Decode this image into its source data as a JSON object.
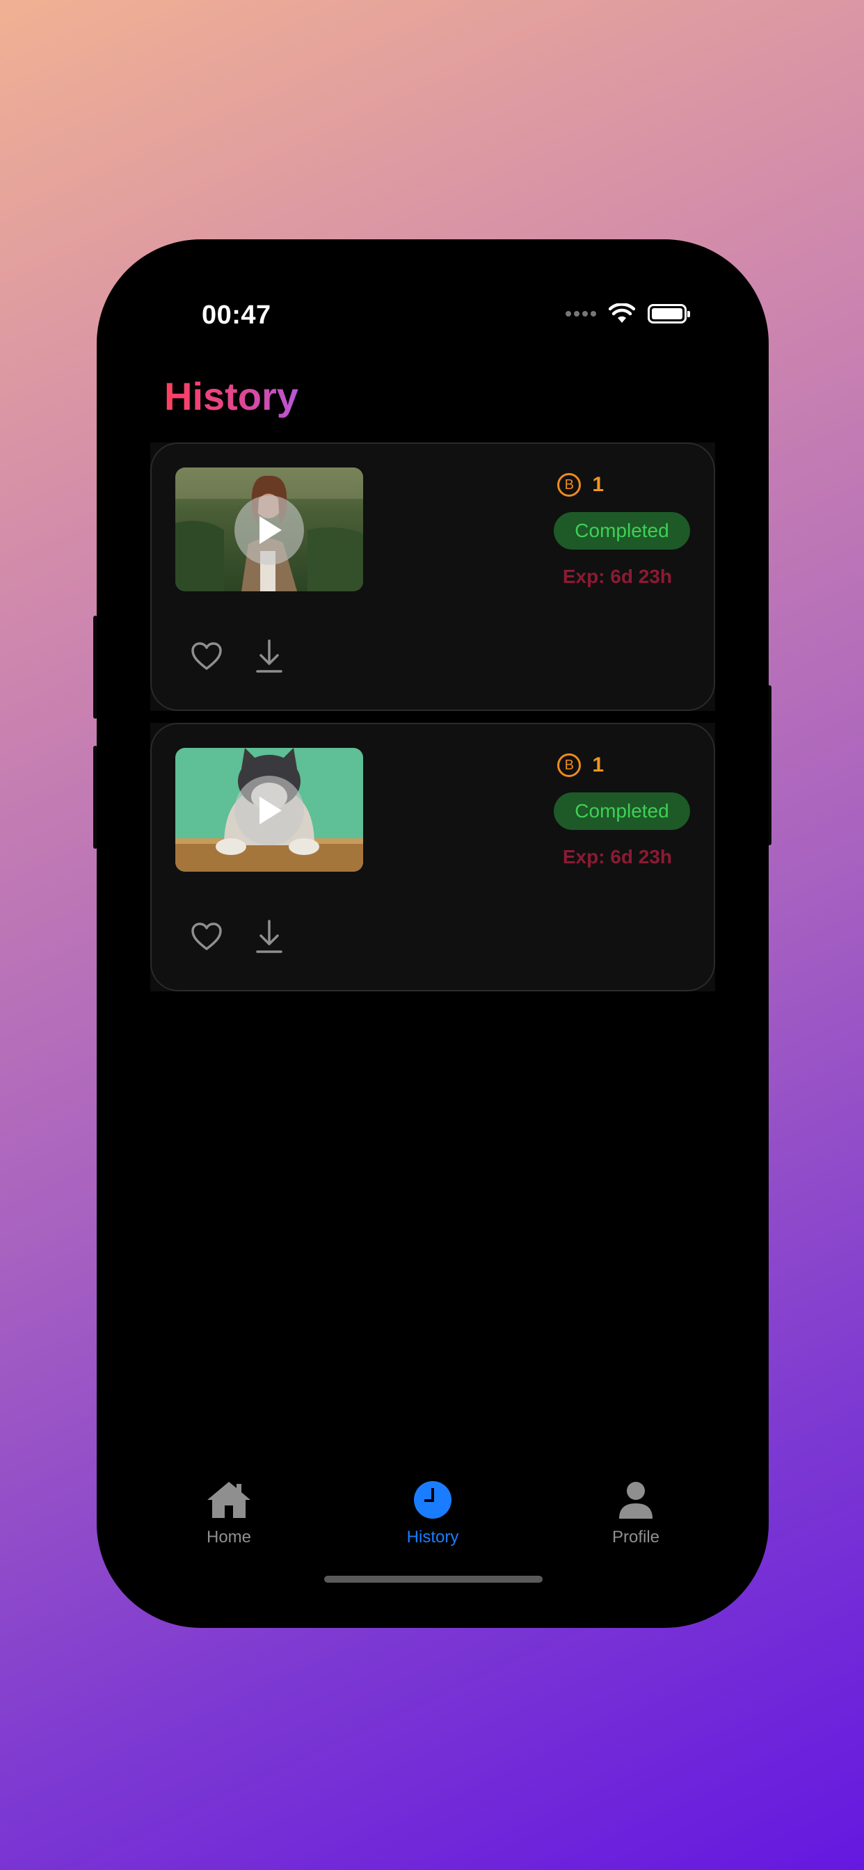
{
  "status_bar": {
    "time": "00:47"
  },
  "header": {
    "title": "History"
  },
  "history_items": [
    {
      "thumbnail": "woman-in-field",
      "coins": "1",
      "status": "Completed",
      "expiry": "Exp: 6d 23h"
    },
    {
      "thumbnail": "cat-on-box",
      "coins": "1",
      "status": "Completed",
      "expiry": "Exp: 6d 23h"
    }
  ],
  "tab_bar": {
    "tabs": [
      {
        "label": "Home",
        "icon": "house-icon",
        "active": false
      },
      {
        "label": "History",
        "icon": "clock-icon",
        "active": true
      },
      {
        "label": "Profile",
        "icon": "person-icon",
        "active": false
      }
    ]
  },
  "colors": {
    "accent": "#1a7dff",
    "coin": "#f0961d",
    "status_bg": "#1d5a27",
    "status_text": "#3fd056",
    "expiry": "#8c1a33"
  }
}
